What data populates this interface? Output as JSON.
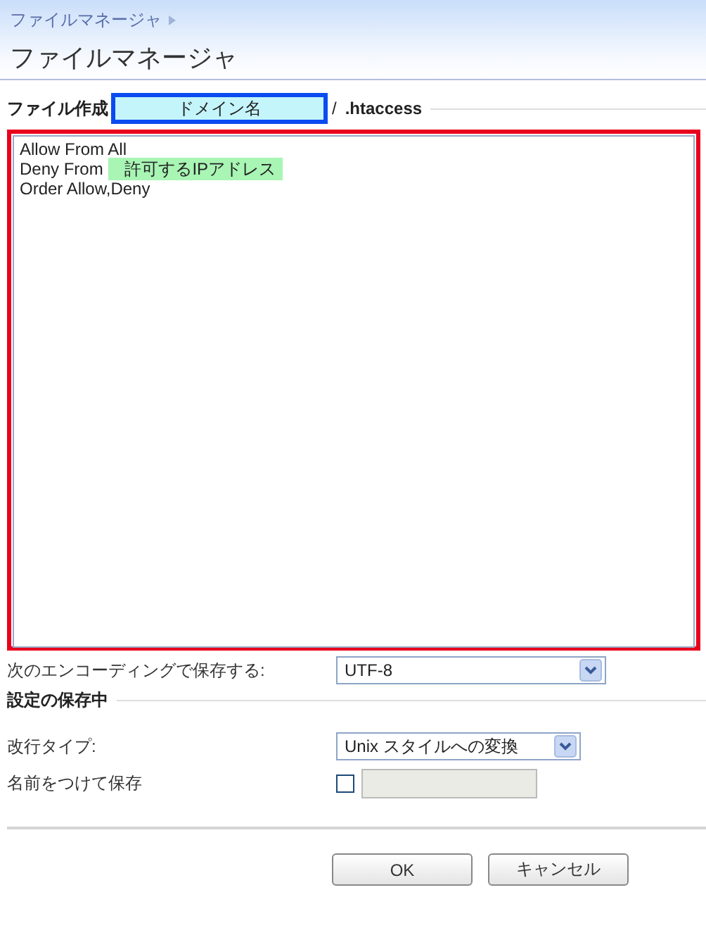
{
  "breadcrumb": {
    "label": "ファイルマネージャ"
  },
  "title": "ファイルマネージャ",
  "file_create": {
    "label": "ファイル作成",
    "domain_field": {
      "value": "ドメイン名"
    },
    "separator": "/",
    "filename": ".htaccess"
  },
  "editor": {
    "lines": [
      {
        "text": "Allow From All"
      },
      {
        "text": "Deny From",
        "highlight": "許可するIPアドレス"
      },
      {
        "text": "Order Allow,Deny"
      }
    ]
  },
  "encoding": {
    "label": "次のエンコーディングで保存する:",
    "value": "UTF-8"
  },
  "section": {
    "title": "設定の保存中"
  },
  "line_break": {
    "label": "改行タイプ:",
    "value": "Unix スタイルへの変換"
  },
  "save_as": {
    "label": "名前をつけて保存",
    "checked": false
  },
  "buttons": [
    {
      "label": "OK"
    },
    {
      "label": "キャンセル"
    }
  ]
}
